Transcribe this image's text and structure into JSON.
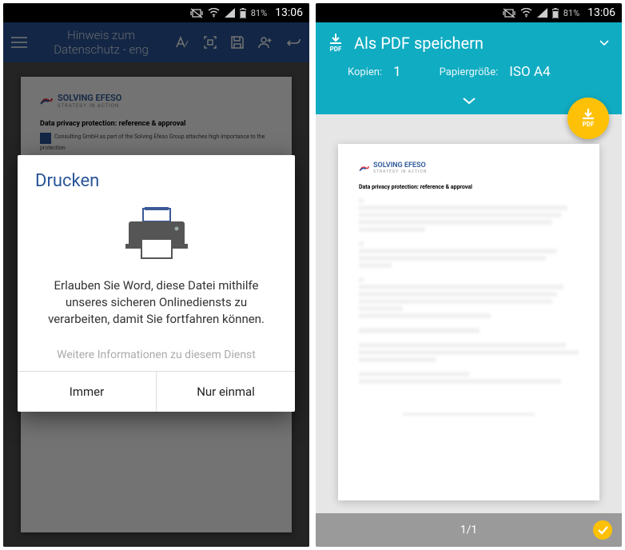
{
  "status": {
    "battery_pct": "81%",
    "clock": "13:06"
  },
  "left": {
    "header": {
      "title": "Hinweis zum Datenschutz - eng"
    },
    "doc": {
      "brand": "SOLVING EFESO",
      "tagline": "STRATEGY IN ACTION",
      "heading": "Data privacy protection: reference & approval",
      "intro": "Consulting GmbH as part of the Solving Efeso Group attaches high importance to the protection"
    },
    "dialog": {
      "title": "Drucken",
      "body": "Erlauben Sie Word, diese Datei mithilfe unseres sicheren Onlinediensts zu verarbeiten, damit Sie fortfahren können.",
      "link": "Weitere Informationen zu diesem Dienst",
      "btn_always": "Immer",
      "btn_once": "Nur einmal"
    }
  },
  "right": {
    "header": {
      "title": "Als PDF speichern",
      "pdf_label": "PDF",
      "copies_label": "Kopien:",
      "copies_value": "1",
      "paper_label": "Papiergröße:",
      "paper_value": "ISO A4",
      "fab_label": "PDF"
    },
    "doc": {
      "brand": "SOLVING EFESO",
      "tagline": "STRATEGY IN ACTION",
      "heading": "Data privacy protection: reference & approval"
    },
    "pager": {
      "text": "1/1"
    }
  }
}
